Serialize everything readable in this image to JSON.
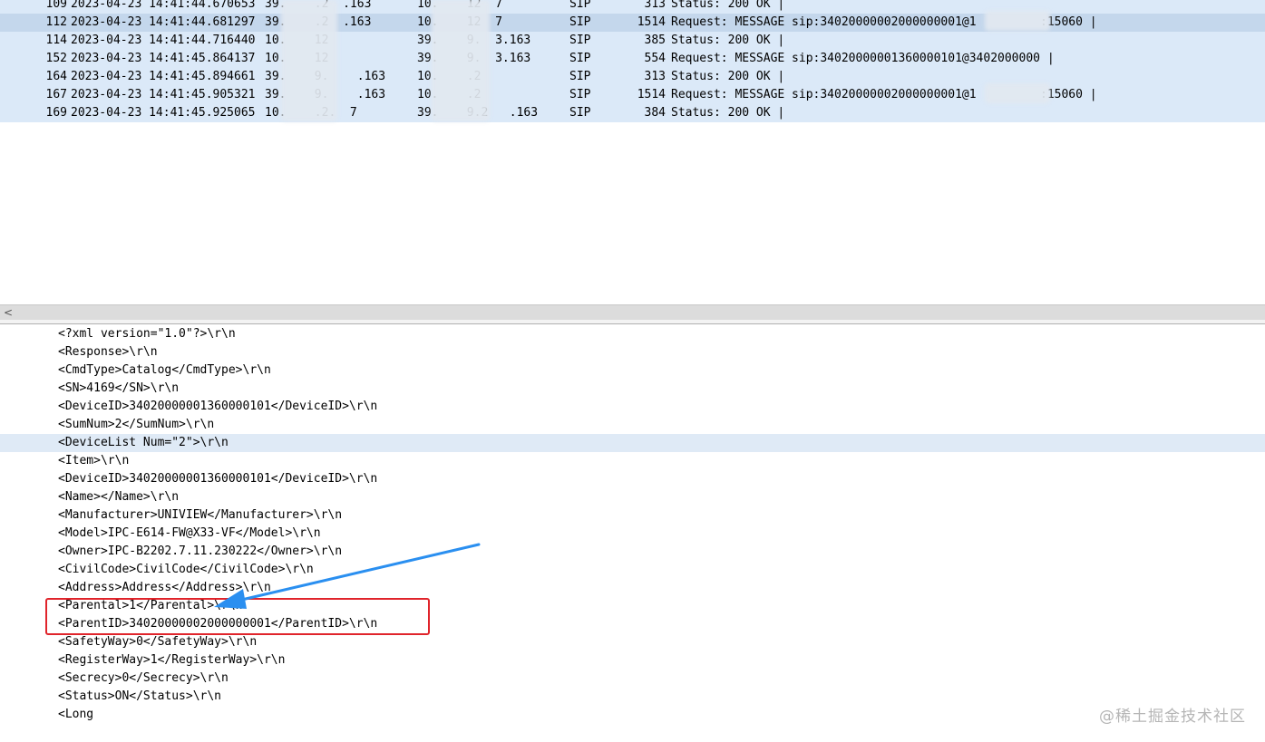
{
  "packet_list": {
    "rows": [
      {
        "no": "109",
        "time": "2023-04-23 14:41:44.670653",
        "src": "39.    .2  .163",
        "dst": "10.    12  7",
        "proto": "SIP",
        "length": "313",
        "info": "Status: 200 OK |"
      },
      {
        "no": "112",
        "time": "2023-04-23 14:41:44.681297",
        "src": "39.    .2  .163",
        "dst": "10.    12  7",
        "proto": "SIP",
        "length": "1514",
        "info": "Request: MESSAGE sip:34020000002000000001@1         :15060 |"
      },
      {
        "no": "114",
        "time": "2023-04-23 14:41:44.716440",
        "src": "10.    12",
        "dst": "39.    9.  3.163",
        "proto": "SIP",
        "length": "385",
        "info": "Status: 200 OK |"
      },
      {
        "no": "152",
        "time": "2023-04-23 14:41:45.864137",
        "src": "10.    12",
        "dst": "39.    9.  3.163",
        "proto": "SIP",
        "length": "554",
        "info": "Request: MESSAGE sip:34020000001360000101@3402000000 |"
      },
      {
        "no": "164",
        "time": "2023-04-23 14:41:45.894661",
        "src": "39.    9.    .163",
        "dst": "10.    .2",
        "proto": "SIP",
        "length": "313",
        "info": "Status: 200 OK |"
      },
      {
        "no": "167",
        "time": "2023-04-23 14:41:45.905321",
        "src": "39.    9.    .163",
        "dst": "10.    .2",
        "proto": "SIP",
        "length": "1514",
        "info": "Request: MESSAGE sip:34020000002000000001@1         :15060 |"
      },
      {
        "no": "169",
        "time": "2023-04-23 14:41:45.925065",
        "src": "10.    .2.  7",
        "dst": "39.    9.2   .163",
        "proto": "SIP",
        "length": "384",
        "info": "Status: 200 OK |"
      }
    ]
  },
  "scrollbar": {
    "left_arrow": "<"
  },
  "xml_view": {
    "lines": [
      "<?xml version=\"1.0\"?>\\r\\n",
      "<Response>\\r\\n",
      "<CmdType>Catalog</CmdType>\\r\\n",
      "<SN>4169</SN>\\r\\n",
      "<DeviceID>34020000001360000101</DeviceID>\\r\\n",
      "<SumNum>2</SumNum>\\r\\n",
      "<DeviceList Num=\"2\">\\r\\n",
      "<Item>\\r\\n",
      "<DeviceID>34020000001360000101</DeviceID>\\r\\n",
      "<Name></Name>\\r\\n",
      "<Manufacturer>UNIVIEW</Manufacturer>\\r\\n",
      "<Model>IPC-E614-FW@X33-VF</Model>\\r\\n",
      "<Owner>IPC-B2202.7.11.230222</Owner>\\r\\n",
      "<CivilCode>CivilCode</CivilCode>\\r\\n",
      "<Address>Address</Address>\\r\\n",
      "<Parental>1</Parental>\\r\\n",
      "<ParentID>34020000002000000001</ParentID>\\r\\n",
      "<SafetyWay>0</SafetyWay>\\r\\n",
      "<RegisterWay>1</RegisterWay>\\r\\n",
      "<Secrecy>0</Secrecy>\\r\\n",
      "<Status>ON</Status>\\r\\n",
      "<Long"
    ]
  },
  "annotation": {
    "arrow_color": "#2a8ff0",
    "box_color": "#e0242b"
  },
  "watermark": "@稀土掘金技术社区"
}
